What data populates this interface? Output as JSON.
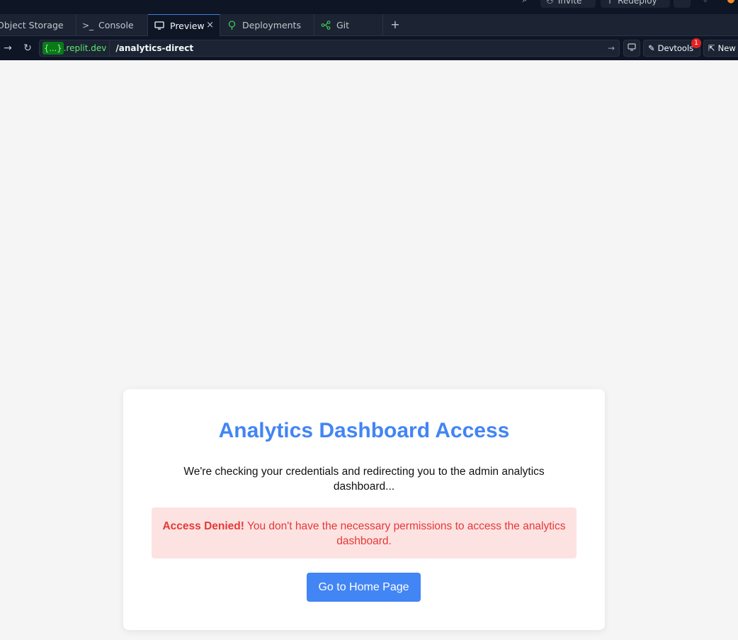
{
  "topbar": {
    "invite_label": "Invite",
    "redeploy_label": "Redeploy"
  },
  "tabs": [
    {
      "label": "Object Storage",
      "icon": "database-icon"
    },
    {
      "label": "Console",
      "icon": "terminal-icon"
    },
    {
      "label": "Preview",
      "icon": "monitor-icon",
      "active": true,
      "close": "×"
    },
    {
      "label": "Deployments",
      "icon": "deployments-icon"
    },
    {
      "label": "Git",
      "icon": "git-icon"
    }
  ],
  "tab_add": "+",
  "urlbar": {
    "host_badge": "{...}",
    "host": ".replit.dev",
    "path": "/analytics-direct",
    "devtools_label": "Devtools",
    "devtools_count": "1",
    "new_tab_label": "New"
  },
  "card": {
    "title": "Analytics Dashboard Access",
    "text": "We're checking your credentials and redirecting you to the admin analytics dashboard...",
    "alert_strong": "Access Denied!",
    "alert_text": " You don't have the necessary permissions to access the analytics dashboard.",
    "button_label": "Go to Home Page"
  },
  "colors": {
    "accent": "#4285f4",
    "error_text": "#e53935",
    "error_bg": "#fde2e2",
    "ide_bg": "#0e1525",
    "page_bg": "#f5f5f5"
  }
}
